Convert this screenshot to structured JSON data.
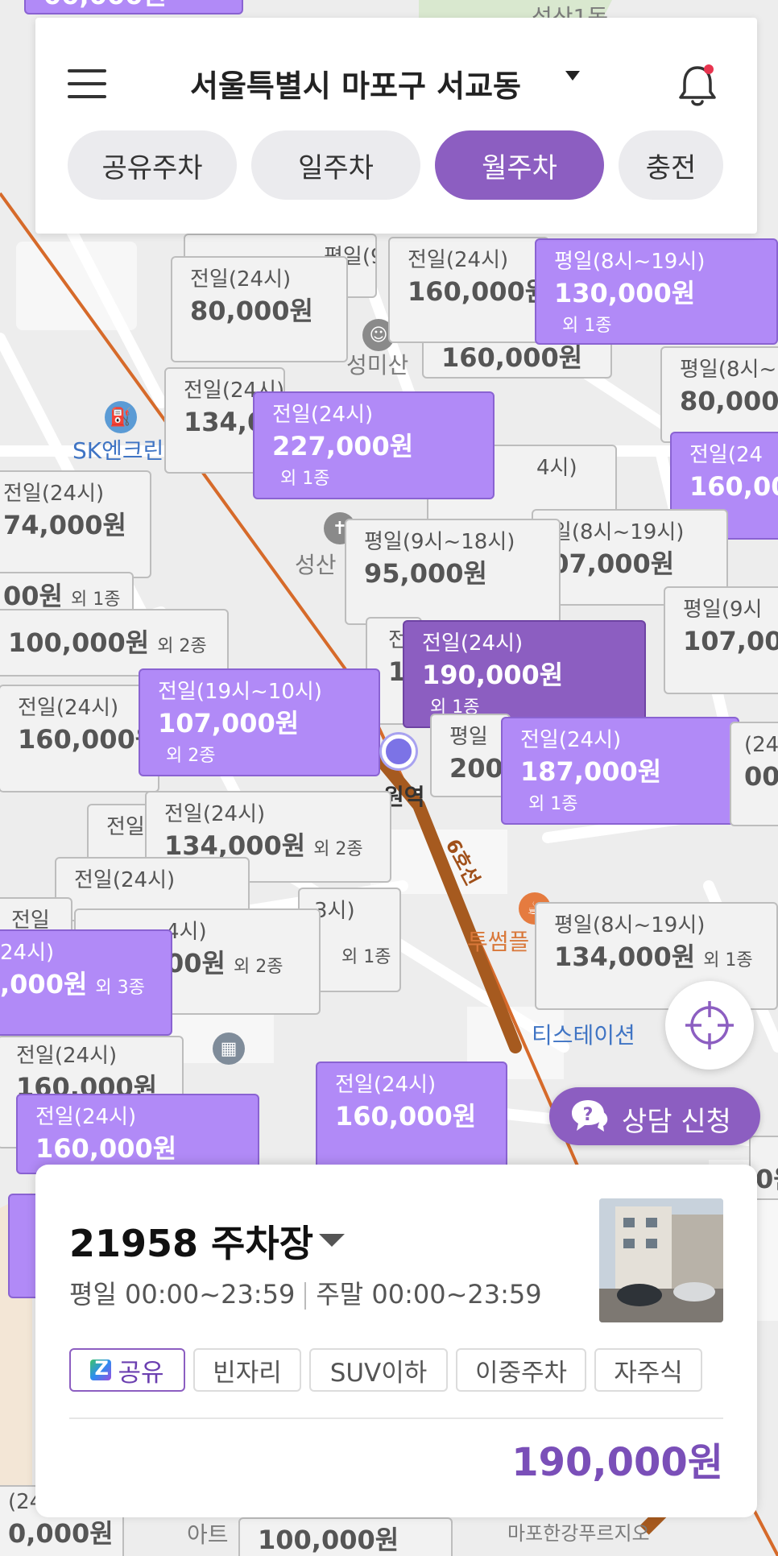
{
  "header": {
    "menu_icon": "hamburger-menu-icon",
    "location": "서울특별시 마포구 서교동",
    "notification_icon": "bell-icon",
    "tabs": [
      {
        "label": "공유주차",
        "active": false
      },
      {
        "label": "일주차",
        "active": false
      },
      {
        "label": "월주차",
        "active": true
      },
      {
        "label": "충전",
        "active": false
      }
    ]
  },
  "map": {
    "places": [
      "SK엔크린",
      "성미산",
      "성산",
      "투썸플",
      "티스테이션",
      "원역",
      "성산1동",
      "마포한강푸르지오",
      "아트",
      "6호선"
    ],
    "markers": [
      {
        "time": "",
        "price": "00,000원",
        "extra": "",
        "style": "purple"
      },
      {
        "time": "평일(9시",
        "price": "",
        "extra": "",
        "style": "gray"
      },
      {
        "time": "전일(24시)",
        "price": "80,000원",
        "extra": "",
        "style": "gray"
      },
      {
        "time": "",
        "price": "160,000원",
        "extra": "",
        "style": "gray"
      },
      {
        "time": "전일(24시)",
        "price": "160,000원",
        "extra": "",
        "style": "gray"
      },
      {
        "time": "평일(8시~19시)",
        "price": "130,000원",
        "extra": "외 1종",
        "style": "purple"
      },
      {
        "time": "전일(24시)",
        "price": "134,0",
        "extra": "",
        "style": "gray"
      },
      {
        "time": "평일(8시~",
        "price": "80,000",
        "extra": "",
        "style": "gray"
      },
      {
        "time": "4시)",
        "price": "160,000원",
        "extra": "",
        "style": "gray"
      },
      {
        "time": "전일(24시)",
        "price": "227,000원",
        "extra": "외 1종",
        "style": "purple"
      },
      {
        "time": "전일(24",
        "price": "160,00",
        "extra": "",
        "style": "purple"
      },
      {
        "time": "전일(24시)",
        "price": "74,000원",
        "extra": "",
        "style": "gray"
      },
      {
        "time": "평일(8시~19시)",
        "price": "107,000원",
        "extra": "",
        "style": "gray"
      },
      {
        "time": "평일(9시~18시)",
        "price": "95,000원",
        "extra": "",
        "style": "gray"
      },
      {
        "time": "",
        "price": "00원",
        "extra": "외 1종",
        "style": "gray"
      },
      {
        "time": "",
        "price": "100,000원",
        "extra": "외 2종",
        "style": "gray"
      },
      {
        "time": "평일(9시",
        "price": "107,00",
        "extra": "",
        "style": "gray"
      },
      {
        "time": "전일",
        "price": "1",
        "extra": "",
        "style": "gray"
      },
      {
        "time": "전일(24시)",
        "price": "190,000원",
        "extra": "외 1종",
        "style": "dark"
      },
      {
        "time": "전일(24시)",
        "price": "160,000원",
        "extra": "",
        "style": "gray"
      },
      {
        "time": "전일(19시~10시)",
        "price": "107,000원",
        "extra": "외 2종",
        "style": "purple"
      },
      {
        "time": "평일",
        "price": "200",
        "extra": "",
        "style": "gray"
      },
      {
        "time": "전일(24시)",
        "price": "187,000원",
        "extra": "외 1종",
        "style": "purple"
      },
      {
        "time": "(24",
        "price": "00",
        "extra": "",
        "style": "gray"
      },
      {
        "time": "전일",
        "price": "",
        "extra": "",
        "style": "gray"
      },
      {
        "time": "전일(24시)",
        "price": "134,000원",
        "extra": "외 2종",
        "style": "gray"
      },
      {
        "time": "전일(24시)",
        "price": "",
        "extra": "",
        "style": "gray"
      },
      {
        "time": "3시)",
        "price": "",
        "extra": "외 1종",
        "style": "gray"
      },
      {
        "time": "전일",
        "price": "",
        "extra": "",
        "style": "gray"
      },
      {
        "time": "4시)",
        "price": "00원",
        "extra": "외 2종",
        "style": "gray"
      },
      {
        "time": "24시)",
        "price": ",000원",
        "extra": "외 3종",
        "style": "purple"
      },
      {
        "time": "평일(8시~19시)",
        "price": "134,000원",
        "extra": "외 1종",
        "style": "gray"
      },
      {
        "time": "전일(24시)",
        "price": "160,000원",
        "extra": "",
        "style": "gray"
      },
      {
        "time": "전일(24시)",
        "price": "160,000원",
        "extra": "",
        "style": "purple"
      },
      {
        "time": "전일(24시)",
        "price": "160,000원",
        "extra": "",
        "style": "purple"
      },
      {
        "time": "(24",
        "price": "0,000원",
        "extra": "",
        "style": "gray"
      },
      {
        "time": "",
        "price": "100,000원",
        "extra": "",
        "style": "gray"
      },
      {
        "time": "",
        "price": "",
        "extra": "",
        "style": "purple"
      },
      {
        "time": "",
        "price": "0원",
        "extra": "",
        "style": "gray"
      }
    ]
  },
  "gps_button": {
    "icon": "crosshair-icon"
  },
  "consult_button": {
    "label": "상담 신청",
    "icon": "chat-question-icon"
  },
  "lot_card": {
    "name": "21958 주차장",
    "weekday_hours": "평일 00:00~23:59",
    "weekend_hours": "주말 00:00~23:59",
    "tags": [
      "공유",
      "빈자리",
      "SUV이하",
      "이중주차",
      "자주식"
    ],
    "price": "190,000원"
  },
  "colors": {
    "accent": "#8c5ec1",
    "marker_purple": "#b18af7",
    "marker_gray": "#f2f2f2"
  }
}
